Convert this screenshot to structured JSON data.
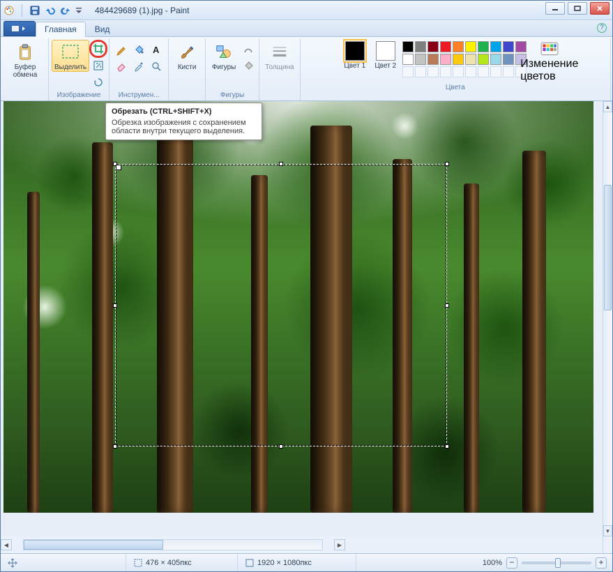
{
  "app_title": "484429689 (1).jpg - Paint",
  "tabs": {
    "file": "",
    "home": "Главная",
    "view": "Вид"
  },
  "ribbon": {
    "clipboard": {
      "label": "Буфер обмена",
      "button": "Буфер обмена"
    },
    "image": {
      "label": "Изображение",
      "select": "Выделить",
      "crop_name": "crop"
    },
    "tools": {
      "label": "Инструмен..."
    },
    "brushes": {
      "label": "",
      "button": "Кисти"
    },
    "shapes": {
      "label": "Фигуры",
      "button": "Фигуры",
      "outline": "",
      "fill": ""
    },
    "size": {
      "label": "",
      "button": "Толщина"
    },
    "colors": {
      "label": "Цвета",
      "color1": "Цвет 1",
      "color2": "Цвет 2",
      "edit": "Изменение цветов",
      "c1_hex": "#000000",
      "c2_hex": "#ffffff",
      "palette": [
        [
          "#000000",
          "#7f7f7f",
          "#880015",
          "#ed1c24",
          "#ff7f27",
          "#fff200",
          "#22b14c",
          "#00a2e8",
          "#3f48cc",
          "#a349a4"
        ],
        [
          "#ffffff",
          "#c3c3c3",
          "#b97a57",
          "#ffaec9",
          "#ffc90e",
          "#efe4b0",
          "#b5e61d",
          "#99d9ea",
          "#7092be",
          "#c8bfe7"
        ],
        [
          "",
          "",
          "",
          "",
          "",
          "",
          "",
          "",
          "",
          ""
        ]
      ]
    }
  },
  "tooltip": {
    "title": "Обрезать (CTRL+SHIFT+X)",
    "body": "Обрезка изображения с сохранением области внутри текущего выделения."
  },
  "status": {
    "cursor": "",
    "selection": "476 × 405пкс",
    "image": "1920 × 1080пкс",
    "zoom": "100%"
  }
}
